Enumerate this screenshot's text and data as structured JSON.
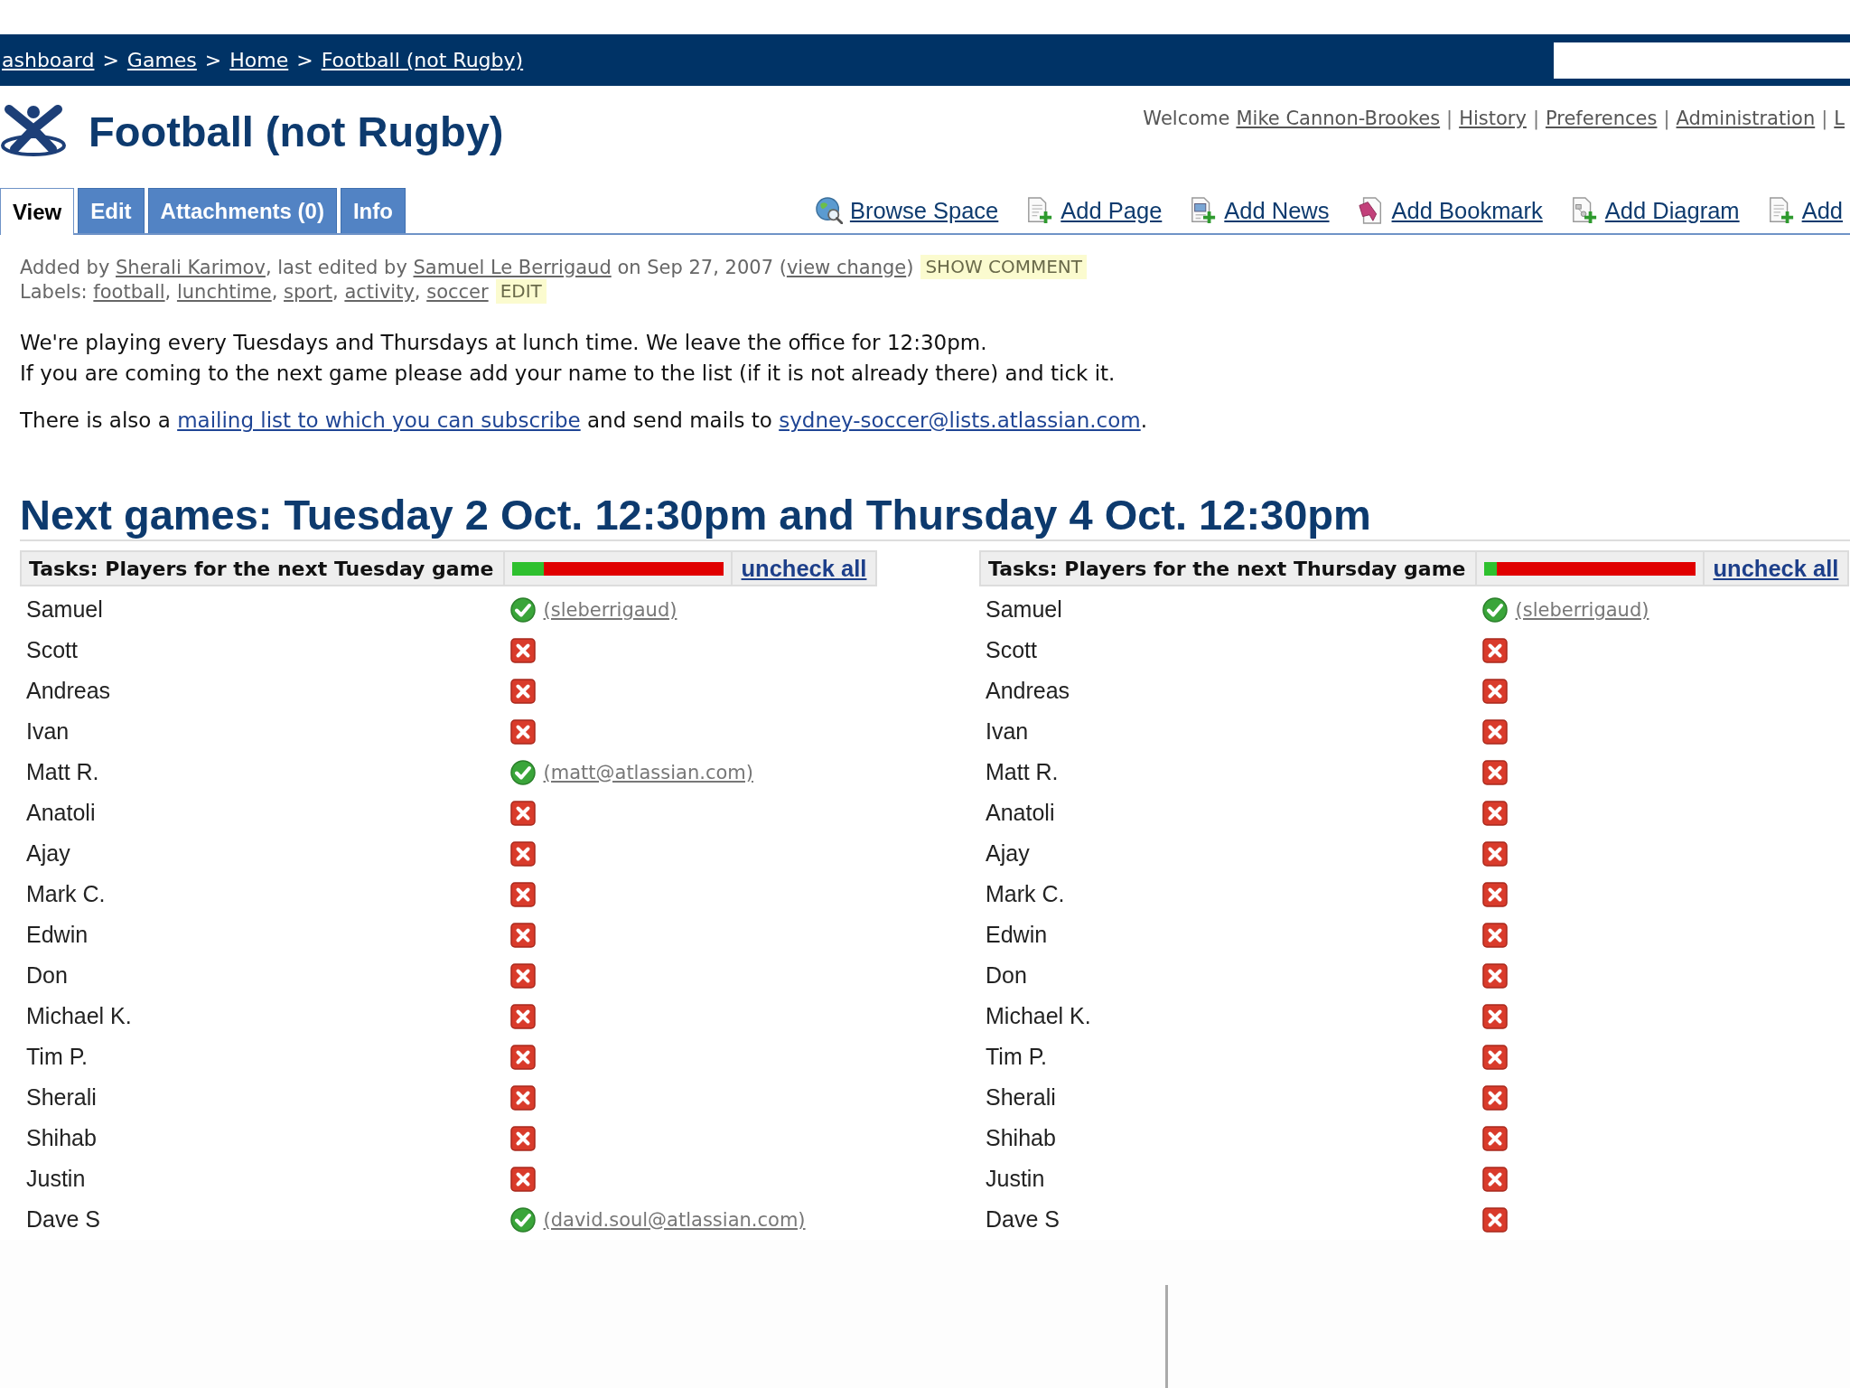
{
  "nav_bar": {
    "breadcrumbs": [
      "ashboard",
      "Games",
      "Home",
      "Football (not Rugby)"
    ],
    "separator": ">"
  },
  "header": {
    "title": "Football (not Rugby)",
    "welcome": "Welcome",
    "user_links": [
      "Mike Cannon-Brookes",
      "History",
      "Preferences",
      "Administration",
      "L"
    ],
    "separator": "|"
  },
  "tabs": [
    {
      "label": "View",
      "selected": true
    },
    {
      "label": "Edit",
      "selected": false
    },
    {
      "label": "Attachments (0)",
      "selected": false
    },
    {
      "label": "Info",
      "selected": false
    }
  ],
  "actions": [
    {
      "kind": "globe",
      "label": "Browse Space"
    },
    {
      "kind": "page",
      "label": "Add Page"
    },
    {
      "kind": "news",
      "label": "Add News"
    },
    {
      "kind": "bookmark",
      "label": "Add Bookmark"
    },
    {
      "kind": "diagram",
      "label": "Add Diagram"
    },
    {
      "kind": "page",
      "label": "Add"
    }
  ],
  "page_meta": {
    "history": [
      {
        "kind": "text",
        "text": "Added by "
      },
      {
        "kind": "link",
        "text": "Sherali Karimov"
      },
      {
        "kind": "text",
        "text": ", last edited by "
      },
      {
        "kind": "link",
        "text": "Samuel Le Berrigaud"
      },
      {
        "kind": "text",
        "text": " on Sep 27, 2007 ("
      },
      {
        "kind": "link",
        "text": "view change"
      },
      {
        "kind": "text",
        "text": ")"
      }
    ],
    "show_comment": "SHOW COMMENT",
    "labels": [
      {
        "kind": "text",
        "text": "Labels: "
      },
      {
        "kind": "link",
        "text": "football"
      },
      {
        "kind": "text",
        "text": ", "
      },
      {
        "kind": "link",
        "text": "lunchtime"
      },
      {
        "kind": "text",
        "text": ", "
      },
      {
        "kind": "link",
        "text": "sport"
      },
      {
        "kind": "text",
        "text": ", "
      },
      {
        "kind": "link",
        "text": "activity"
      },
      {
        "kind": "text",
        "text": ", "
      },
      {
        "kind": "link",
        "text": "soccer"
      }
    ],
    "edit_labels": "EDIT"
  },
  "intro": {
    "lines": [
      "We're playing every Tuesdays and Thursdays at lunch time. We leave the office for 12:30pm.",
      "If you are coming to the next game please add your name to the list (if it is not already there) and tick it."
    ],
    "mailing": [
      {
        "kind": "text",
        "text": "There is also a "
      },
      {
        "kind": "link",
        "text": "mailing list to which you can subscribe"
      },
      {
        "kind": "text",
        "text": " and send mails to "
      },
      {
        "kind": "link",
        "text": "sydney-soccer@lists.atlassian.com"
      },
      {
        "kind": "text",
        "text": "."
      }
    ]
  },
  "heading": "Next games: Tuesday 2 Oct. 12:30pm and Thursday 4 Oct. 12:30pm",
  "task_lists": [
    {
      "title": "Tasks: Players for the next Tuesday game",
      "level": 0.15,
      "uncheck_all": "uncheck all",
      "players": [
        {
          "name": "Samuel",
          "checked": true,
          "user": "(sleberrigaud)"
        },
        {
          "name": "Scott",
          "checked": false
        },
        {
          "name": "Andreas",
          "checked": false
        },
        {
          "name": "Ivan",
          "checked": false
        },
        {
          "name": "Matt R.",
          "checked": true,
          "user": "(matt@atlassian.com)"
        },
        {
          "name": "Anatoli",
          "checked": false
        },
        {
          "name": "Ajay",
          "checked": false
        },
        {
          "name": "Mark C.",
          "checked": false
        },
        {
          "name": "Edwin",
          "checked": false
        },
        {
          "name": "Don",
          "checked": false
        },
        {
          "name": "Michael K.",
          "checked": false
        },
        {
          "name": "Tim P.",
          "checked": false
        },
        {
          "name": "Sherali",
          "checked": false
        },
        {
          "name": "Shihab",
          "checked": false
        },
        {
          "name": "Justin",
          "checked": false
        },
        {
          "name": "Dave S",
          "checked": true,
          "user": "(david.soul@atlassian.com)"
        }
      ]
    },
    {
      "title": "Tasks: Players for the next Thursday game",
      "level": 0.06,
      "uncheck_all": "uncheck all",
      "players": [
        {
          "name": "Samuel",
          "checked": true,
          "user": "(sleberrigaud)"
        },
        {
          "name": "Scott",
          "checked": false
        },
        {
          "name": "Andreas",
          "checked": false
        },
        {
          "name": "Ivan",
          "checked": false
        },
        {
          "name": "Matt R.",
          "checked": false
        },
        {
          "name": "Anatoli",
          "checked": false
        },
        {
          "name": "Ajay",
          "checked": false
        },
        {
          "name": "Mark C.",
          "checked": false
        },
        {
          "name": "Edwin",
          "checked": false
        },
        {
          "name": "Don",
          "checked": false
        },
        {
          "name": "Michael K.",
          "checked": false
        },
        {
          "name": "Tim P.",
          "checked": false
        },
        {
          "name": "Sherali",
          "checked": false
        },
        {
          "name": "Shihab",
          "checked": false
        },
        {
          "name": "Justin",
          "checked": false
        },
        {
          "name": "Dave S",
          "checked": false
        }
      ]
    }
  ]
}
